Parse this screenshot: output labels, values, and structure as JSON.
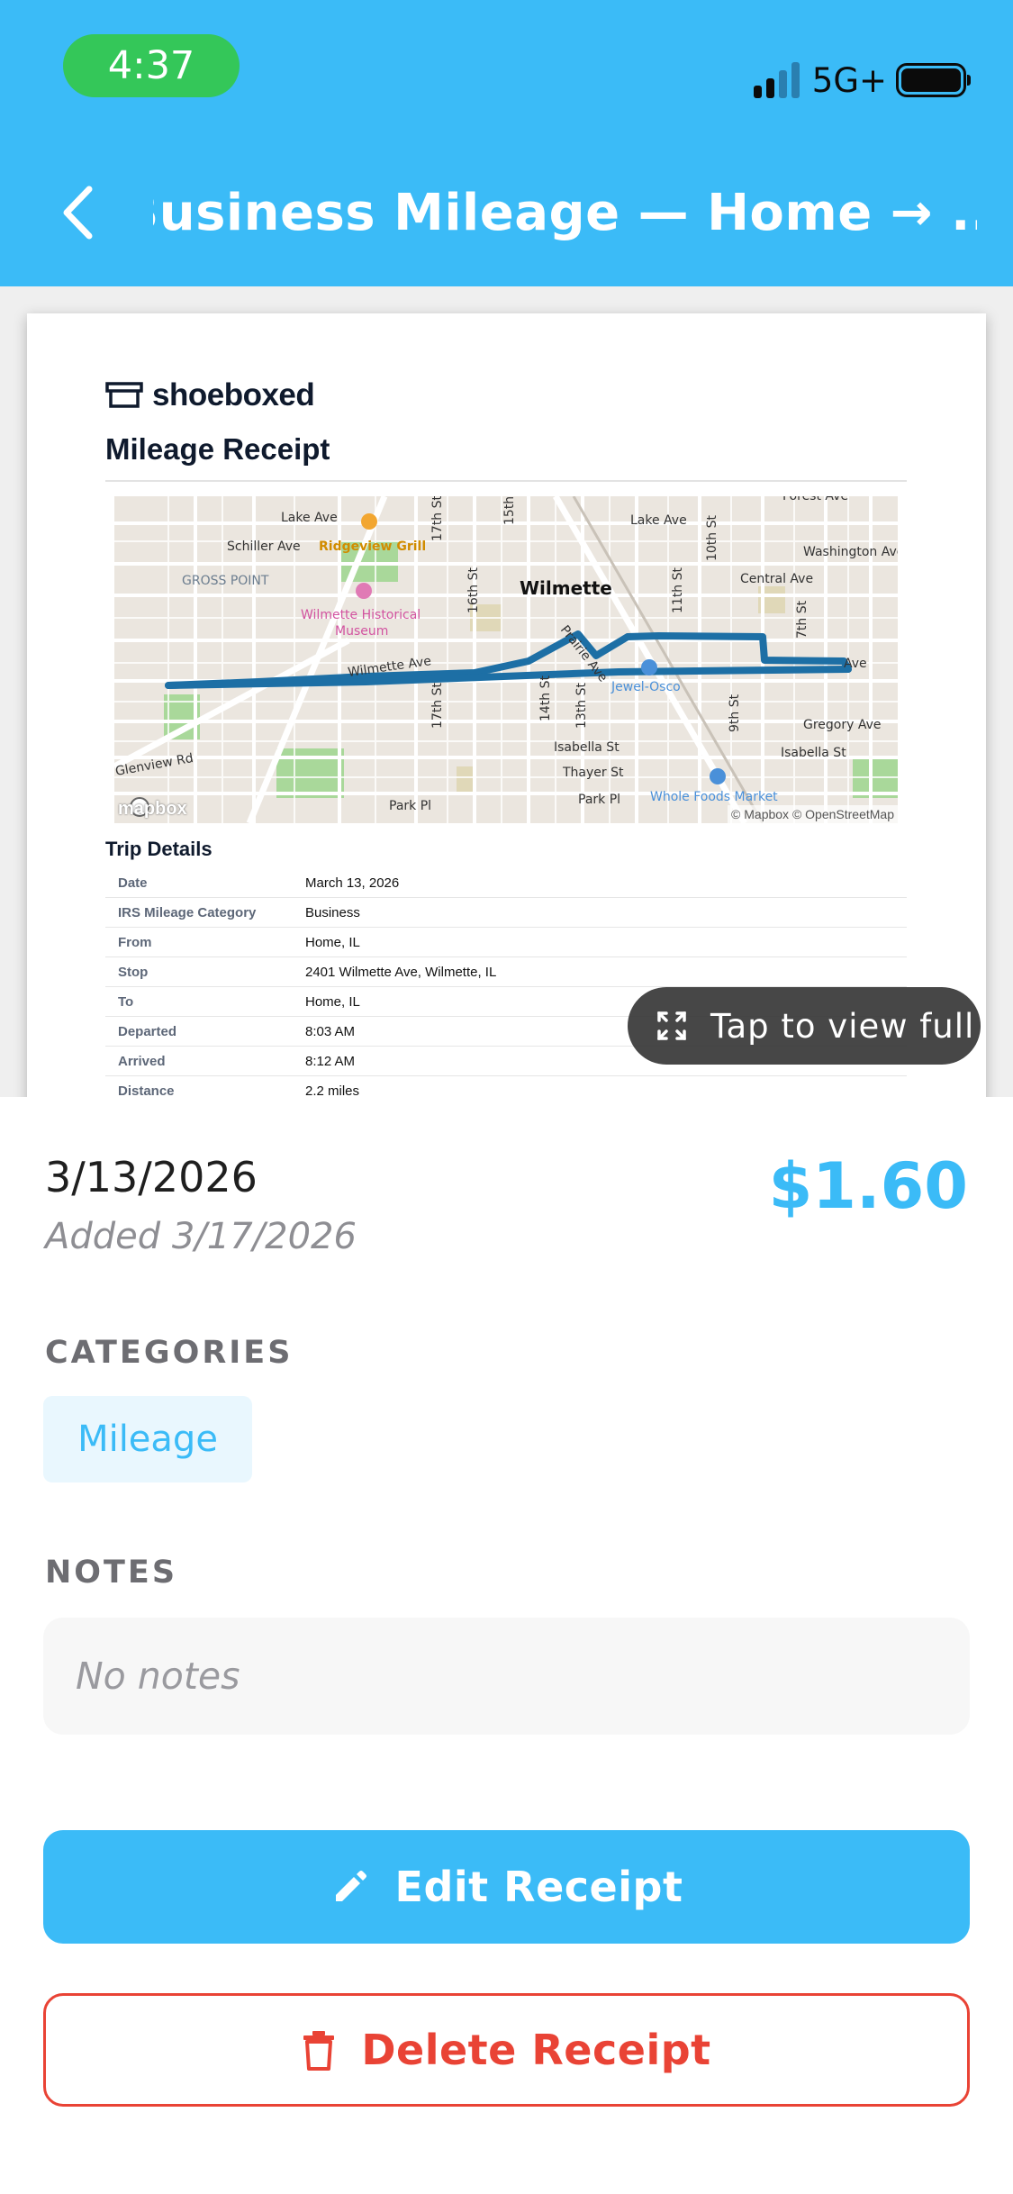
{
  "status_bar": {
    "time": "4:37",
    "network": "5G+"
  },
  "header": {
    "title": "Business Mileage — Home → ...",
    "back_icon": "chevron-left-icon"
  },
  "preview": {
    "brand": "shoeboxed",
    "doc_title": "Mileage Receipt",
    "map": {
      "logo": "mapbox",
      "attribution": "© Mapbox © OpenStreetMap",
      "labels": {
        "forest": "Forest Ave",
        "lake_left": "Lake Ave",
        "lake_right": "Lake Ave",
        "schiller": "Schiller Ave",
        "ridgeview": "Ridgeview Grill",
        "washington": "Washington Ave",
        "gross_point": "GROSS POINT",
        "central": "Central Ave",
        "wilmette": "Wilmette",
        "museum1": "Wilmette Historical",
        "museum2": "Museum",
        "prairie": "Prairie Ave",
        "wilmette_ave": "Wilmette Ave",
        "ave_right": "Ave",
        "jewel": "Jewel-Osco",
        "gregory": "Gregory Ave",
        "isabella_mid": "Isabella St",
        "isabella_right": "Isabella St",
        "glenview": "Glenview Rd",
        "thayer": "Thayer St",
        "park_left": "Park Pl",
        "park_mid": "Park Pl",
        "whole_foods": "Whole Foods Market",
        "s17_top": "17th St",
        "s15_top": "15th",
        "s16": "16th St",
        "s17_bottom": "17th St",
        "s14": "14th St",
        "s13": "13th St",
        "s11": "11th St",
        "s10": "10th St",
        "s9": "9th St",
        "s7": "7th St"
      }
    },
    "trip_heading": "Trip Details",
    "trip_rows": [
      {
        "label": "Date",
        "value": "March 13, 2026"
      },
      {
        "label": "IRS Mileage Category",
        "value": "Business"
      },
      {
        "label": "From",
        "value": "Home, IL"
      },
      {
        "label": "Stop",
        "value": "2401 Wilmette Ave, Wilmette, IL"
      },
      {
        "label": "To",
        "value": "Home, IL"
      },
      {
        "label": "Departed",
        "value": "8:03 AM"
      },
      {
        "label": "Arrived",
        "value": "8:12 AM"
      },
      {
        "label": "Distance",
        "value": "2.2 miles"
      }
    ],
    "tap_label": "Tap to view full"
  },
  "details": {
    "date": "3/13/2026",
    "added": "Added 3/17/2026",
    "amount": "$1.60",
    "categories_label": "CATEGORIES",
    "category": "Mileage",
    "notes_label": "NOTES",
    "notes_placeholder": "No notes"
  },
  "actions": {
    "edit_label": "Edit Receipt",
    "delete_label": "Delete Receipt"
  },
  "colors": {
    "accent": "#3bbbf7",
    "danger": "#e94335",
    "status_pill": "#34c759",
    "route": "#1d6fa5"
  }
}
